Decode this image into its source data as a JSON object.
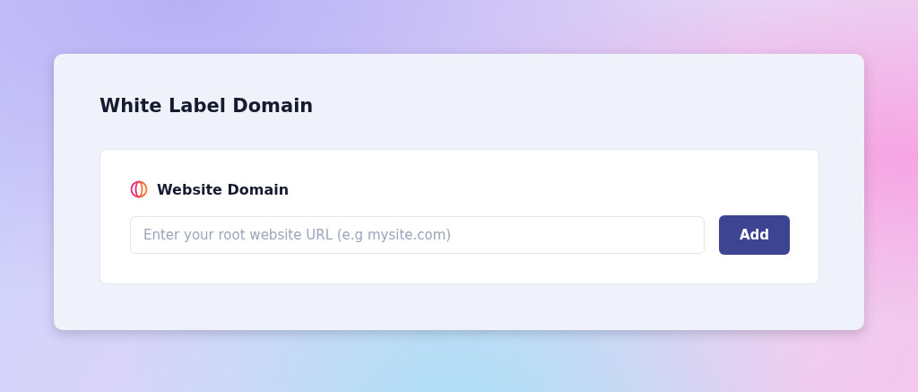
{
  "title": "White Label Domain",
  "section": {
    "heading": "Website Domain",
    "input": {
      "placeholder": "Enter your root website URL (e.g mysite.com)"
    },
    "button": "Add"
  }
}
